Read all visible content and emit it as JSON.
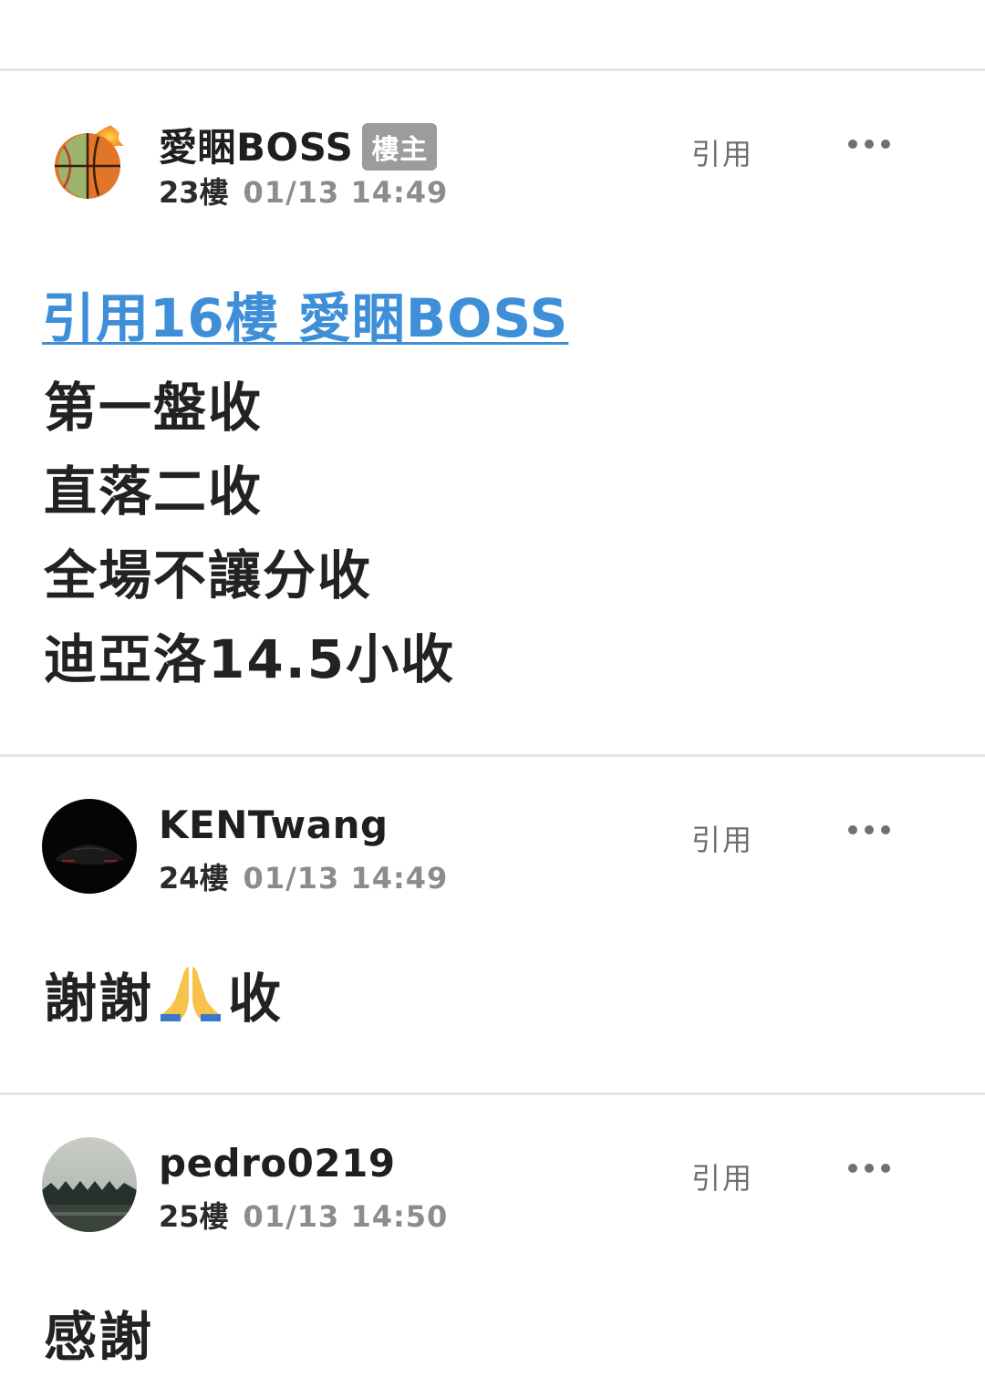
{
  "posts": [
    {
      "author": "愛睏BOSS",
      "badge": "樓主",
      "floor": "23樓",
      "time": "01/13 14:49",
      "quote_label": "引用",
      "more_icon": "more-horizontal-icon",
      "avatar_icon": "fireball-sports-avatar",
      "quote_link": "引用16樓 愛睏BOSS",
      "lines": [
        "第一盤收",
        "直落二收",
        "全場不讓分收",
        "迪亞洛14.5小收"
      ]
    },
    {
      "author": "KENTwang",
      "floor": "24樓",
      "time": "01/13 14:49",
      "quote_label": "引用",
      "more_icon": "more-horizontal-icon",
      "avatar_icon": "dark-car-avatar",
      "body_text": "謝謝",
      "body_emoji": "praying-hands-emoji",
      "body_tail": "收"
    },
    {
      "author": "pedro0219",
      "floor": "25樓",
      "time": "01/13 14:50",
      "quote_label": "引用",
      "more_icon": "more-horizontal-icon",
      "avatar_icon": "building-sky-avatar",
      "body_text": "感謝"
    }
  ],
  "colors": {
    "link": "#3e8fd8",
    "badge_bg": "#9c9c9c",
    "divider": "#e4e4e4",
    "meta_gray": "#8c8c8c"
  }
}
